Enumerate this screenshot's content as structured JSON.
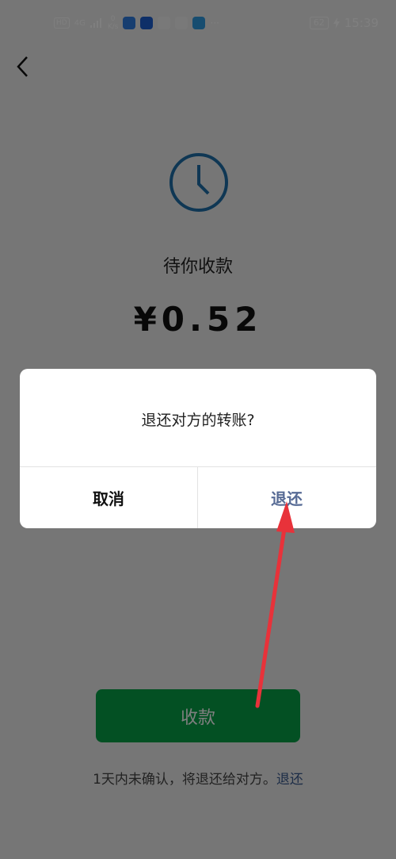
{
  "status_bar": {
    "hd": "HD",
    "network": "4G",
    "speed_value": "0",
    "speed_unit": "K/s",
    "more": "···",
    "battery": "62",
    "time": "15:39"
  },
  "main": {
    "wait_label": "待你收款",
    "amount": "¥0.52",
    "collect_button": "收款",
    "footer_note": "1天内未确认，将退还给对方。",
    "footer_link": "退还"
  },
  "dialog": {
    "message": "退还对方的转账?",
    "cancel": "取消",
    "refund": "退还"
  },
  "colors": {
    "accent_green": "#07a047",
    "link_blue": "#576b95",
    "clock_blue": "#1e6fa8",
    "arrow_red": "#e8323a"
  }
}
